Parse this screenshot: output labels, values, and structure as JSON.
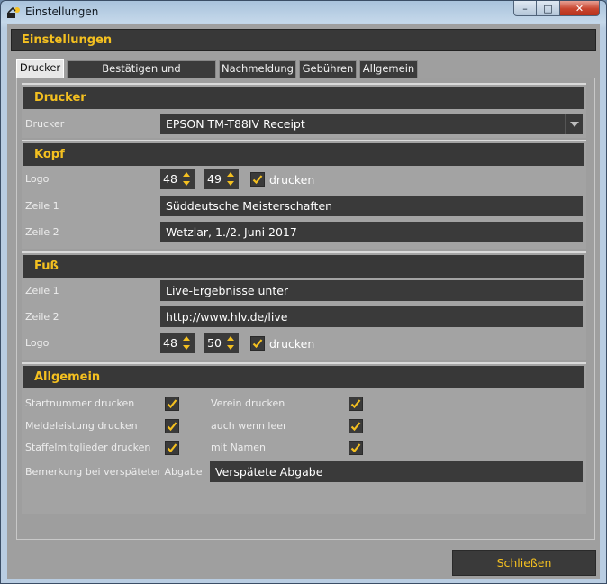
{
  "window": {
    "title": "Einstellungen",
    "min_label": "–",
    "max_label": "□",
    "close_label": "✕"
  },
  "header": {
    "title": "Einstellungen"
  },
  "tabs": [
    {
      "label": "Drucker",
      "active": true
    },
    {
      "label": "Bestätigen und Zurückziehen",
      "active": false
    },
    {
      "label": "Nachmeldung",
      "active": false
    },
    {
      "label": "Gebühren",
      "active": false
    },
    {
      "label": "Allgemein",
      "active": false
    }
  ],
  "drucker": {
    "title": "Drucker",
    "label": "Drucker",
    "value": "EPSON TM-T88IV Receipt"
  },
  "kopf": {
    "title": "Kopf",
    "logo_label": "Logo",
    "logo_a": "48",
    "logo_b": "49",
    "print_label": "drucken",
    "print_checked": true,
    "zeile1_label": "Zeile 1",
    "zeile1_value": "Süddeutsche Meisterschaften",
    "zeile2_label": "Zeile 2",
    "zeile2_value": "Wetzlar, 1./2. Juni 2017"
  },
  "fuss": {
    "title": "Fuß",
    "zeile1_label": "Zeile 1",
    "zeile1_value": "Live-Ergebnisse unter",
    "zeile2_label": "Zeile 2",
    "zeile2_value": "http://www.hlv.de/live",
    "logo_label": "Logo",
    "logo_a": "48",
    "logo_b": "50",
    "print_label": "drucken",
    "print_checked": true
  },
  "allgemein": {
    "title": "Allgemein",
    "startnummer": "Startnummer drucken",
    "meldeleistung": "Meldeleistung drucken",
    "staffel": "Staffelmitglieder drucken",
    "verein": "Verein drucken",
    "auch_wenn_leer": "auch wenn leer",
    "mit_namen": "mit Namen",
    "bemerkung_label": "Bemerkung bei verspäteter Abgabe",
    "bemerkung_value": "Verspätete Abgabe"
  },
  "footer": {
    "close_label": "Schließen"
  },
  "colors": {
    "accent": "#f4c020",
    "dark": "#383838",
    "panel": "#9f9f9f"
  }
}
